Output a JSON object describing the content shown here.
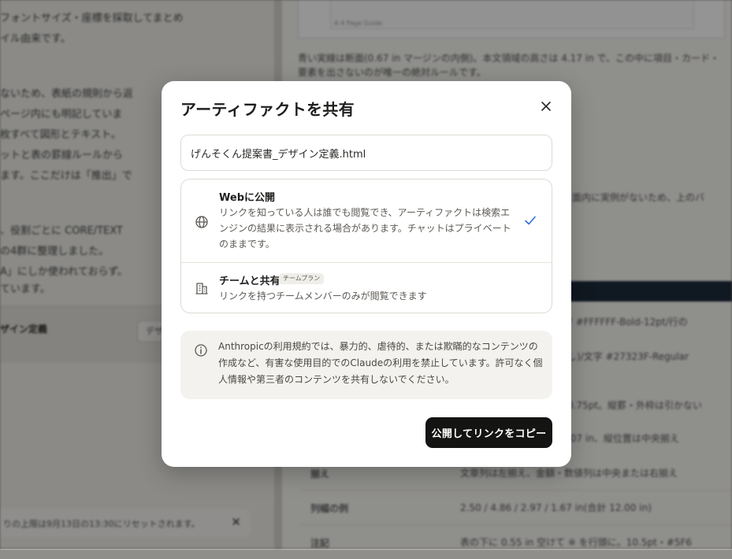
{
  "background": {
    "left_lines": [
      "フォントサイズ・座標を採取してまとめ",
      "イル由来です。",
      "ないため、表紙の規則から返",
      "ページ内にも明記していま",
      "枚すべて図形とテキスト。",
      "ットと表の罫線ルールから",
      "ます。ここだけは「推出」で",
      "、役割ごとに CORE/TEXT",
      "の4群に整理しました。",
      "A」にしか使われておらず。",
      "ています。"
    ],
    "doc_row_title": "ザイン定義",
    "doc_row_chip": "デザ",
    "notice_text": "りの上限は9月13日の13:30にリセットされます。",
    "notice_close": "✕",
    "right_card_caption": "A 4 Page Guide",
    "right_paragraph_lines": [
      "青い実線は断面(0.67 in マージンの内側)。本文領域の高さは 4.17 in で、この中に項目・カード・",
      "要素を出さないのが唯一の絶対ルールです。"
    ],
    "right_snippets": [
      "面内に実例がないため、上のバ",
      "F #FFFFFF-Bold-12pt/行の",
      "し)/文字 #27323F-Regular",
      "0.75pt。縦罫・外枠は引かない",
      ".07 in、縦位置は中央揃え"
    ],
    "table_rows": [
      {
        "key": "揃え",
        "value": "文章列は左揃え、金額・数値列は中央または右揃え"
      },
      {
        "key": "列幅の例",
        "value": "2.50 / 4.86 / 2.97 / 1.67 in(合計 12.00 in)"
      },
      {
        "key": "注記",
        "value": "表の下に 0.55 in 空けて ※ を行頭に。10.5pt・#5F6"
      }
    ]
  },
  "modal": {
    "title": "アーティファクトを共有",
    "close_icon": "close-icon",
    "filename": "げんそくん提案書_デザイン定義.html",
    "options": [
      {
        "name": "Webに公開",
        "description": "リンクを知っている人は誰でも閲覧でき、アーティファクトは検索エンジンの結果に表示される場合があります。チャットはプライベートのままです。",
        "icon": "globe-icon",
        "selected": true
      },
      {
        "name": "チームと共有",
        "badge": "チームプラン",
        "description": "リンクを持つチームメンバーのみが閲覧できます",
        "icon": "building-icon",
        "selected": false
      }
    ],
    "warning": "Anthropicの利用規約では、暴力的、虐待的、または欺瞞的なコンテンツの作成など、有害な使用目的でのClaudeの利用を禁止しています。許可なく個人情報や第三者のコンテンツを共有しないでください。",
    "primary_button": "公開してリンクをコピー"
  },
  "colors": {
    "accent_check": "#2b6fd6",
    "primary_button_bg": "#141413",
    "overlay": "rgba(0,0,0,0.42)"
  }
}
